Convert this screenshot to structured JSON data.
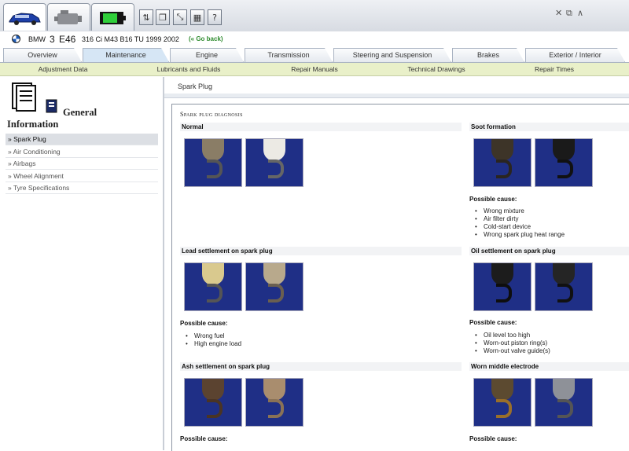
{
  "vehicle": {
    "make": "BMW",
    "series": "3",
    "model": "E46",
    "details": "316 Ci M43 B16 TU 1999 2002",
    "go_back": "(« Go back)"
  },
  "main_tabs": [
    "Overview",
    "Maintenance",
    "Engine",
    "Transmission",
    "Steering and Suspension",
    "Brakes",
    "Exterior / Interior"
  ],
  "main_tab_active": "Maintenance",
  "sub_tabs": [
    "Adjustment Data",
    "Lubricants and Fluids",
    "Repair Manuals",
    "Technical Drawings",
    "Repair Times"
  ],
  "sidebar": {
    "heading_line1": "General",
    "heading_line2": "Information",
    "items": [
      "Spark Plug",
      "Air Conditioning",
      "Airbags",
      "Wheel Alignment",
      "Tyre Specifications"
    ],
    "marker": "»",
    "active": "Spark Plug"
  },
  "content": {
    "page_title": "Spark Plug",
    "diagnosis_title": "Spark plug diagnosis",
    "possible_cause_label": "Possible cause:",
    "sections": [
      {
        "title": "Normal",
        "causes": []
      },
      {
        "title": "Soot formation",
        "causes": [
          "Wrong mixture",
          "Air filter dirty",
          "Cold-start device",
          "Wrong spark plug heat range"
        ]
      },
      {
        "title": "Lead settlement on spark plug",
        "causes": [
          "Wrong fuel",
          "High engine load"
        ]
      },
      {
        "title": "Oil settlement on spark plug",
        "causes": [
          "Oil level too high",
          "Worn-out piston ring(s)",
          "Worn-out valve guide(s)"
        ]
      },
      {
        "title": "Ash settlement on spark plug",
        "causes": []
      },
      {
        "title": "Worn middle electrode",
        "causes": []
      }
    ]
  },
  "toolbar": {
    "icons": [
      "fluid-transfer-icon",
      "copy-icon",
      "resize-icon",
      "calculator-icon",
      "help-icon"
    ],
    "glyphs": [
      "⇅",
      "❐",
      "⤡",
      "▦",
      "?"
    ],
    "window_controls": [
      "✕",
      "⧉",
      "∧"
    ]
  },
  "colors": {
    "photo_background": "#1f2f86",
    "active_main_tab": "#d6e6f5",
    "sub_tab_bar": "#e9f0c9",
    "go_back_link": "#2e8b2e"
  }
}
